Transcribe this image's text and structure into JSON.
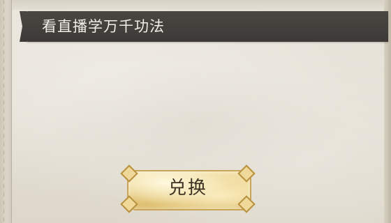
{
  "header": {
    "title": "看直播学万千功法"
  },
  "actions": {
    "redeem_label": "兑换"
  },
  "colors": {
    "title_bar": "#3c3936",
    "title_text": "#f2efe8",
    "button_gold": "#e9d08a",
    "button_text": "#3d3223",
    "paper": "#e6e1d7"
  }
}
